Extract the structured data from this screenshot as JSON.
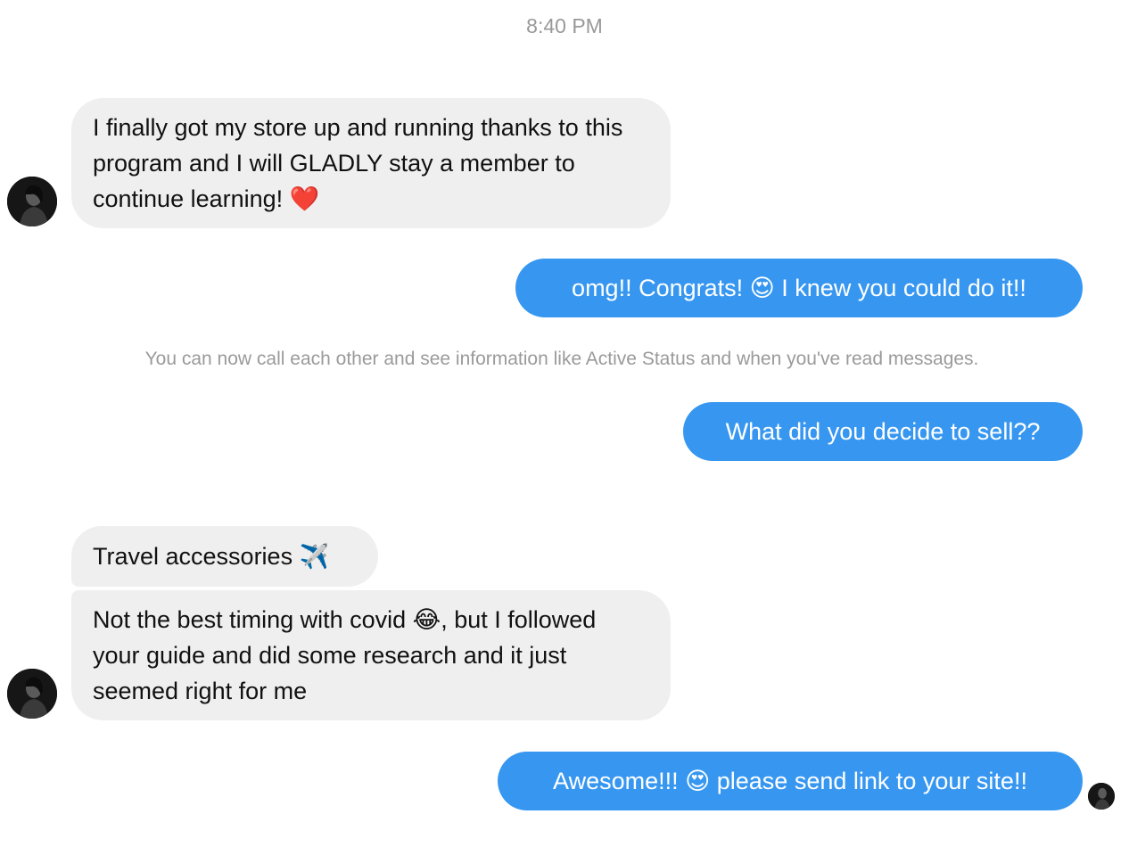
{
  "conversation": {
    "timestamp": "8:40 PM",
    "system_note": "You can now call each other and see information like Active Status and when you've read messages.",
    "messages": [
      {
        "from": "them",
        "text": "I finally got my store up and running thanks to this program and I will GLADLY stay a member to continue learning! ❤️"
      },
      {
        "from": "me",
        "text": "omg!! Congrats! 😍 I knew you could do it!!"
      },
      {
        "from": "me",
        "text": "What did you decide to sell??"
      },
      {
        "from": "them",
        "text": "Travel accessories ✈️"
      },
      {
        "from": "them",
        "text": "Not the best timing with covid 😂, but I followed your guide and did some research and it just seemed right for me"
      },
      {
        "from": "me",
        "text": "Awesome!!! 😍 please send link to your site!!"
      }
    ]
  },
  "colors": {
    "outgoing_bubble": "#3797f0",
    "incoming_bubble": "#efefef",
    "meta_text": "#999999"
  },
  "icons": {
    "avatar": "profile-photo-avatar"
  }
}
